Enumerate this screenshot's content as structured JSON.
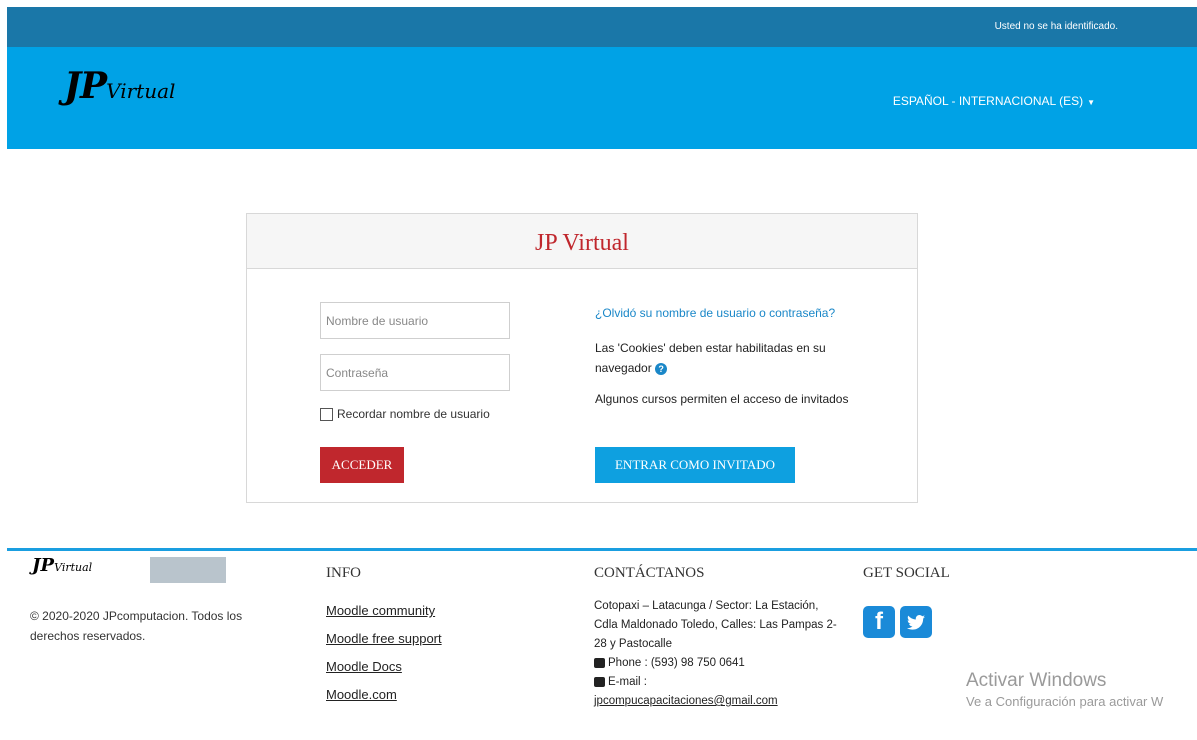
{
  "topbar": {
    "login_status": "Usted no se ha identificado."
  },
  "header": {
    "logo": {
      "big": "JP",
      "small": "Virtual"
    },
    "language": "ESPAÑOL - INTERNACIONAL (ES)"
  },
  "login": {
    "title": "JP Virtual",
    "username_placeholder": "Nombre de usuario",
    "password_placeholder": "Contraseña",
    "remember_label": "Recordar nombre de usuario",
    "submit_label": "ACCEDER",
    "forgot_link": "¿Olvidó su nombre de usuario o contraseña?",
    "cookies_note": "Las 'Cookies' deben estar habilitadas en su navegador",
    "guest_note": "Algunos cursos permiten el acceso de invitados",
    "guest_button": "ENTRAR COMO INVITADO"
  },
  "footer": {
    "logo": {
      "big": "JP",
      "small": "Virtual"
    },
    "copyright": "© 2020-2020 JPcomputacion. Todos los derechos reservados.",
    "info_title": "INFO",
    "info_links": [
      "Moodle community",
      "Moodle free support",
      "Moodle Docs",
      "Moodle.com"
    ],
    "contact_title": "CONTÁCTANOS",
    "contact_address": "Cotopaxi – Latacunga / Sector: La Estación, Cdla Maldonado Toledo, Calles: Las Pampas 2-28 y Pastocalle",
    "contact_phone": "Phone : (593) 98 750 0641",
    "contact_email_label": "E-mail :",
    "contact_email": "jpcompucapacitaciones@gmail.com",
    "social_title": "GET SOCIAL",
    "social": [
      {
        "icon": "facebook-icon",
        "glyph": "f"
      },
      {
        "icon": "twitter-icon",
        "glyph": "t"
      }
    ]
  },
  "watermark": {
    "line1": "Activar Windows",
    "line2": "Ve a Configuración para activar W"
  },
  "colors": {
    "topbar": "#1a77a8",
    "header": "#00a2e6",
    "accent_red": "#c0272d",
    "accent_blue": "#0ea0e0"
  }
}
